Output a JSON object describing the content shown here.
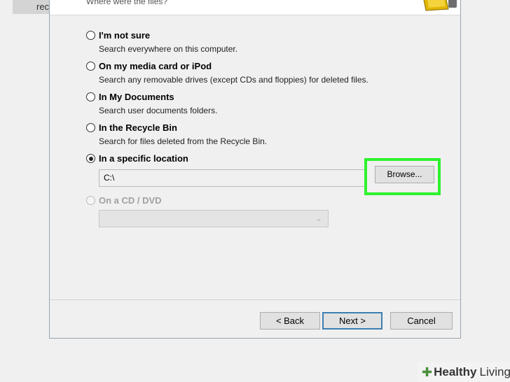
{
  "background": {
    "partial_text": "rec"
  },
  "dialog": {
    "prompt": "Where were the files?",
    "options": [
      {
        "label": "I'm not sure",
        "description": "Search everywhere on this computer.",
        "selected": false,
        "enabled": true
      },
      {
        "label": "On my media card or iPod",
        "description": "Search any removable drives (except CDs and floppies) for deleted files.",
        "selected": false,
        "enabled": true
      },
      {
        "label": "In My Documents",
        "description": "Search user documents folders.",
        "selected": false,
        "enabled": true
      },
      {
        "label": "In the Recycle Bin",
        "description": "Search for files deleted from the Recycle Bin.",
        "selected": false,
        "enabled": true
      },
      {
        "label": "In a specific location",
        "description": "",
        "selected": true,
        "enabled": true
      },
      {
        "label": "On a CD / DVD",
        "description": "",
        "selected": false,
        "enabled": false
      }
    ],
    "location_value": "C:\\",
    "browse_label": "Browse...",
    "buttons": {
      "back": "< Back",
      "next": "Next >",
      "cancel": "Cancel"
    }
  },
  "watermark": {
    "word1": "Healthy",
    "word2": "Living"
  },
  "colors": {
    "highlight": "#2ef22e",
    "default_button_border": "#3c7fb1"
  }
}
